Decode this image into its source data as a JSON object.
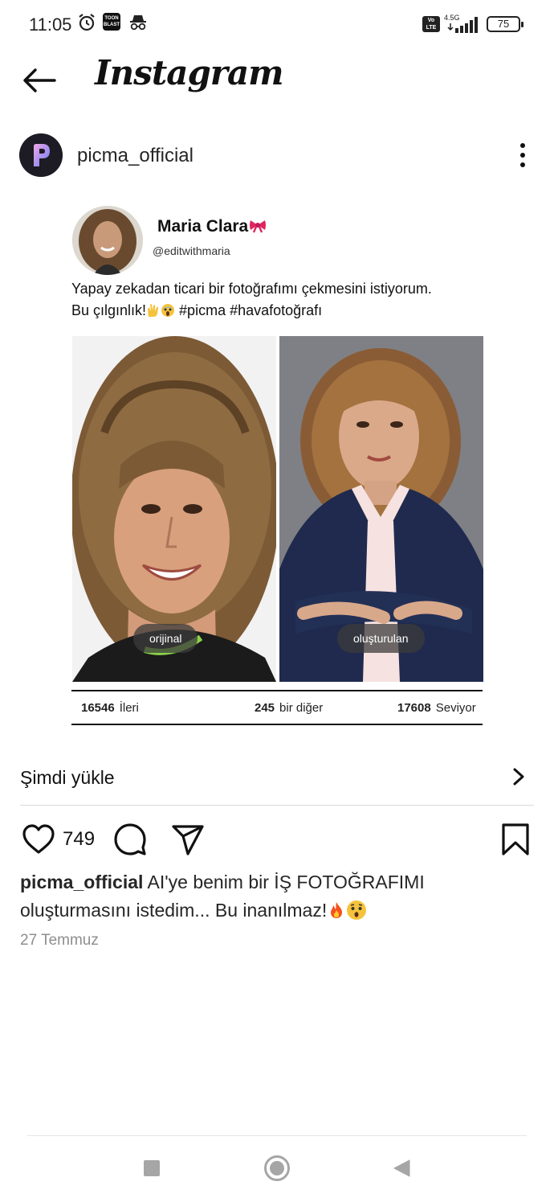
{
  "status_bar": {
    "time": "11:05",
    "toon_label": "TOON BLAST",
    "volte_label": "Vo LTE",
    "network_label": "4.5G",
    "battery": "75"
  },
  "header": {
    "title": "Instagram",
    "back_icon": "arrow-left-icon"
  },
  "post": {
    "account_name": "picma_official",
    "avatar_letter": "P",
    "card": {
      "name": "Maria Clara",
      "handle": "@editwithmaria",
      "text_line1": "Yapay zekadan ticari bir fotoğrafımı çekmesini istiyorum.",
      "text_line2_start": "Bu çılgınlık!",
      "text_line2_end": " #picma #havafotoğrafı",
      "photo_original_label": "orijinal",
      "photo_generated_label": "oluşturulan",
      "stats": [
        {
          "value": "16546",
          "label": "İleri"
        },
        {
          "value": "245",
          "label": "bir diğer"
        },
        {
          "value": "17608",
          "label": "Seviyor"
        }
      ]
    },
    "cta_label": "Şimdi yükle",
    "like_count": "749",
    "caption_user": "picma_official",
    "caption_text": " AI'ye benim bir İŞ FOTOĞRAFIMI oluşturmasını istedim... Bu inanılmaz!",
    "date": "27 Temmuz"
  },
  "colors": {
    "text": "#262626",
    "secondary_text": "#8e8e8e",
    "divider": "#dbdbdb",
    "avatar_bg": "#1d1b24",
    "avatar_gradient_start": "#e9a4f2",
    "avatar_gradient_end": "#6f7bf7"
  }
}
